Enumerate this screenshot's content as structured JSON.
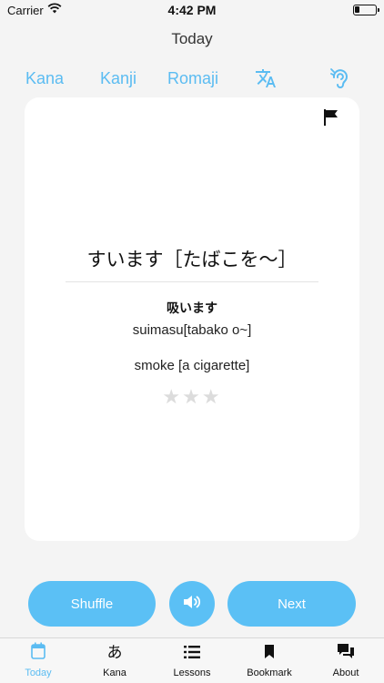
{
  "status_bar": {
    "carrier": "Carrier",
    "time": "4:42 PM"
  },
  "nav": {
    "title": "Today"
  },
  "mode_tabs": [
    {
      "label": "Kana"
    },
    {
      "label": "Kanji"
    },
    {
      "label": "Romaji"
    },
    {
      "icon": "translate-icon"
    },
    {
      "icon": "hearing-icon"
    }
  ],
  "card": {
    "kana": "すいます［たばこを～］",
    "kanji": "吸います",
    "romaji": "suimasu[tabako o~]",
    "meaning": "smoke [a cigarette]",
    "stars": "★★★",
    "rating": 0,
    "rating_max": 3,
    "flag_icon": "flag-icon"
  },
  "actions": {
    "shuffle_label": "Shuffle",
    "sound_icon": "speaker-icon",
    "next_label": "Next"
  },
  "tab_bar": [
    {
      "label": "Today",
      "icon": "calendar-icon",
      "active": true
    },
    {
      "label": "Kana",
      "icon": "hiragana-a-icon",
      "glyph": "あ"
    },
    {
      "label": "Lessons",
      "icon": "list-icon"
    },
    {
      "label": "Bookmark",
      "icon": "bookmark-icon"
    },
    {
      "label": "About",
      "icon": "chat-bubbles-icon"
    }
  ],
  "colors": {
    "accent": "#5bbcf2",
    "button": "#5bc0f5",
    "background": "#f4f4f4",
    "card": "#ffffff",
    "star_empty": "#dcdcdc"
  }
}
